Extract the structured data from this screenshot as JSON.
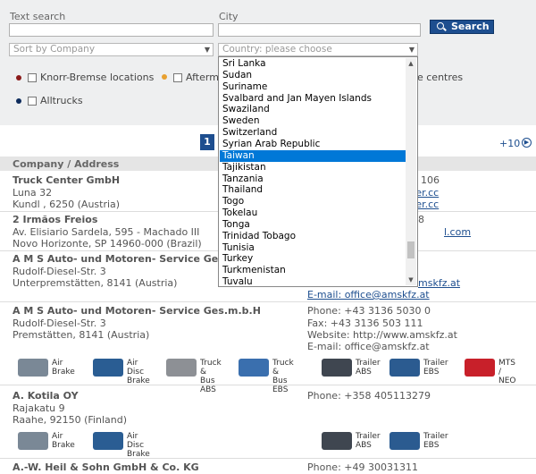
{
  "search": {
    "text_label": "Text search",
    "text_value": "",
    "city_label": "City",
    "city_value": "",
    "button_label": "Search",
    "sort_value": "Sort by Company",
    "country_value": "Country: please choose"
  },
  "filters": [
    {
      "label": "Knorr-Bremse locations",
      "dot_color": "#8b1a1a"
    },
    {
      "label": "Afterma",
      "dot_color": "#e8a030"
    },
    {
      "label": "e centres",
      "dot_color": ""
    },
    {
      "label": "Alltrucks",
      "dot_color": "#0d2b5c"
    }
  ],
  "pagination": {
    "current": "1",
    "next": "+10"
  },
  "table": {
    "header": "Company / Address"
  },
  "entries": [
    {
      "name": "Truck Center GmbH",
      "lines": [
        "Luna 32",
        "Kundl ,  6250 (Austria)"
      ],
      "contact": [
        "106",
        "ter.cc",
        "ter.cc"
      ]
    },
    {
      "name": "2 Irmãos Freios",
      "lines": [
        "Av. Elisiario Sardela, 595 - Machado III",
        "Novo Horizonte, SP 14960-000 (Brazil)"
      ],
      "contact": [
        "8",
        "",
        "l.com"
      ]
    },
    {
      "name": "A M S Auto- und Motoren- Service Ges.m.b.H",
      "lines": [
        "Rudolf-Diesel-Str. 3",
        "Unterpremstätten,  8141 (Austria)"
      ],
      "contact": [
        "mskfz.at",
        "E-mail: office@amskfz.at"
      ]
    },
    {
      "name": "A M S Auto- und Motoren- Service Ges.m.b.H",
      "lines": [
        "Rudolf-Diesel-Str. 3",
        "Premstätten,  8141 (Austria)"
      ],
      "contact": [
        "Phone: +43 3136 5030 0",
        "Fax: +43 3136 503 111",
        "Website: http://www.amskfz.at",
        "E-mail: office@amskfz.at"
      ]
    },
    {
      "name": "A. Kotila OY",
      "lines": [
        "Rajakatu 9",
        "Raahe,  92150 (Finland)"
      ],
      "contact": [
        "Phone: +358 405113279"
      ]
    },
    {
      "name": "A.-W. Heil & Sohn GmbH & Co. KG",
      "lines": [],
      "contact": [
        "Phone: +49 30031311"
      ]
    }
  ],
  "products_row1": [
    {
      "label1": "Air",
      "label2": "Brake",
      "icon": "air-brake-icon",
      "color": "#7a8896"
    },
    {
      "label1": "Air Disc",
      "label2": "Brake",
      "icon": "air-disc-brake-icon",
      "color": "#2a5d93"
    },
    {
      "label1": "Truck &",
      "label2": "Bus ABS",
      "icon": "truck-bus-abs-icon",
      "color": "#8d9095"
    },
    {
      "label1": "Truck &",
      "label2": "Bus EBS",
      "icon": "truck-bus-ebs-icon",
      "color": "#3a6fae"
    },
    {
      "label1": "Trailer",
      "label2": "ABS",
      "icon": "trailer-abs-icon",
      "color": "#3f4650"
    },
    {
      "label1": "Trailer",
      "label2": "EBS",
      "icon": "trailer-ebs-icon",
      "color": "#2b5b90"
    },
    {
      "label1": "MTS /",
      "label2": "NEO",
      "icon": "mts-neo-icon",
      "color": "#c8202a"
    }
  ],
  "products_row2": [
    {
      "label1": "Air",
      "label2": "Brake",
      "icon": "air-brake-icon",
      "color": "#7a8896"
    },
    {
      "label1": "Air Disc",
      "label2": "Brake",
      "icon": "air-disc-brake-icon",
      "color": "#2a5d93"
    },
    {
      "label1": "Trailer",
      "label2": "ABS",
      "icon": "trailer-abs-icon",
      "color": "#3f4650"
    },
    {
      "label1": "Trailer",
      "label2": "EBS",
      "icon": "trailer-ebs-icon",
      "color": "#2b5b90"
    }
  ],
  "country_options": [
    "Sri Lanka",
    "Sudan",
    "Suriname",
    "Svalbard and Jan Mayen Islands",
    "Swaziland",
    "Sweden",
    "Switzerland",
    "Syrian Arab Republic",
    "Taiwan",
    "Tajikistan",
    "Tanzania",
    "Thailand",
    "Togo",
    "Tokelau",
    "Tonga",
    "Trinidad Tobago",
    "Tunisia",
    "Turkey",
    "Turkmenistan",
    "Tuvalu"
  ],
  "selected_country": "Taiwan",
  "colors": {
    "accent": "#1d4e8f",
    "selection": "#0078d7"
  }
}
